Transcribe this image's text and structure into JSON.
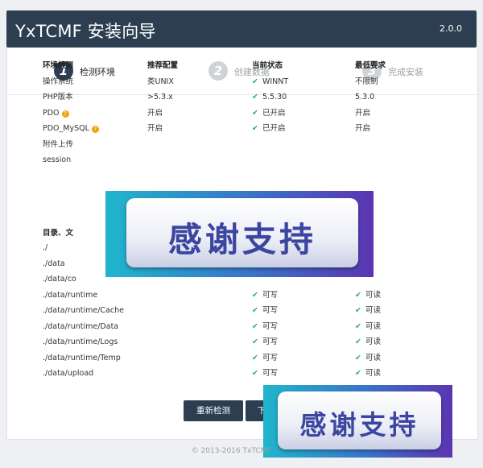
{
  "header": {
    "title": "YxTCMF 安装向导",
    "version": "2.0.0"
  },
  "steps": [
    {
      "num": "1",
      "label": "检测环境"
    },
    {
      "num": "2",
      "label": "创建数据"
    },
    {
      "num": "3",
      "label": "完成安装"
    }
  ],
  "env": {
    "headers": [
      "环境检测",
      "推荐配置",
      "当前状态",
      "最低要求"
    ],
    "rows": [
      {
        "name": "操作系统",
        "recommended": "类UNIX",
        "current": "WINNT",
        "minimum": "不限制"
      },
      {
        "name": "PHP版本",
        "recommended": ">5.3.x",
        "current": "5.5.30",
        "minimum": "5.3.0"
      },
      {
        "name": "PDO",
        "recommended": "开启",
        "current": "已开启",
        "minimum": "开启"
      },
      {
        "name": "PDO_MySQL",
        "recommended": "开启",
        "current": "已开启",
        "minimum": "开启"
      },
      {
        "name": "附件上传",
        "recommended": "",
        "current": "",
        "minimum": ""
      },
      {
        "name": "session",
        "recommended": "",
        "current": "",
        "minimum": ""
      }
    ]
  },
  "dirs": {
    "header": "目录、文",
    "rows": [
      {
        "path": "./",
        "write": "",
        "read": ""
      },
      {
        "path": "./data",
        "write": "",
        "read": ""
      },
      {
        "path": "./data/co",
        "write": "",
        "read": ""
      },
      {
        "path": "./data/runtime",
        "write": "可写",
        "read": "可读"
      },
      {
        "path": "./data/runtime/Cache",
        "write": "可写",
        "read": "可读"
      },
      {
        "path": "./data/runtime/Data",
        "write": "可写",
        "read": "可读"
      },
      {
        "path": "./data/runtime/Logs",
        "write": "可写",
        "read": "可读"
      },
      {
        "path": "./data/runtime/Temp",
        "write": "可写",
        "read": "可读"
      },
      {
        "path": "./data/upload",
        "write": "可写",
        "read": "可读"
      }
    ]
  },
  "buttons": {
    "recheck": "重新检测",
    "next": "下"
  },
  "overlay": {
    "text": "感谢支持"
  },
  "footer": "© 2013-2016 TxTCMF         "
}
